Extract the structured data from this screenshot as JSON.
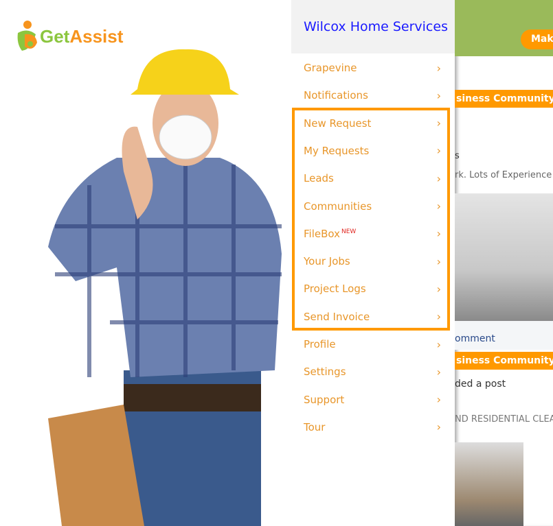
{
  "logo": {
    "text_green": "Get",
    "text_orange": "Assist"
  },
  "menu": {
    "title": "Wilcox Home Services",
    "items": [
      {
        "label": "Grapevine"
      },
      {
        "label": "Notifications"
      },
      {
        "label": "New Request"
      },
      {
        "label": "My Requests"
      },
      {
        "label": "Leads"
      },
      {
        "label": "Communities"
      },
      {
        "label": "FileBox",
        "badge": "NEW"
      },
      {
        "label": "Your Jobs"
      },
      {
        "label": "Project Logs"
      },
      {
        "label": "Send Invoice"
      },
      {
        "label": "Profile"
      },
      {
        "label": "Settings"
      },
      {
        "label": "Support"
      },
      {
        "label": "Tour"
      }
    ],
    "highlight_color": "#ff9900"
  },
  "background_app": {
    "button": "Make",
    "banner1": "siness Community",
    "line1": "s",
    "line2": "rk.  Lots of Experience",
    "comment": "omment",
    "banner2": "siness Community",
    "line3": "ded a post",
    "line4": "ND RESIDENTIAL CLEA"
  },
  "colors": {
    "accent": "#ff9900",
    "header_green": "#9aba5a",
    "title_blue": "#1a1aff"
  }
}
